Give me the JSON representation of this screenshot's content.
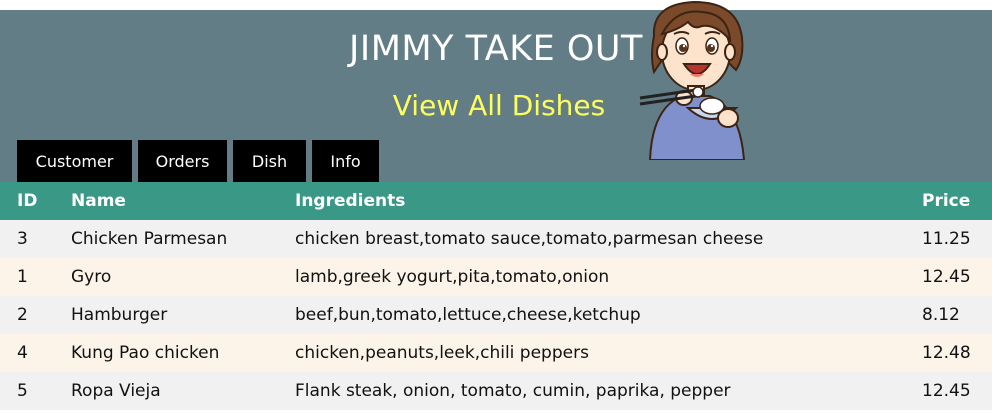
{
  "header": {
    "title": "JIMMY TAKE OUT",
    "subtitle": "View All Dishes",
    "mascot_icon": "chef-eating-rice-icon"
  },
  "nav": {
    "items": [
      {
        "label": "Customer"
      },
      {
        "label": "Orders"
      },
      {
        "label": "Dish"
      },
      {
        "label": "Info"
      }
    ]
  },
  "table": {
    "columns": [
      "ID",
      "Name",
      "Ingredients",
      "Price"
    ],
    "rows": [
      {
        "id": "3",
        "name": "Chicken Parmesan",
        "ingredients": "chicken breast,tomato sauce,tomato,parmesan cheese",
        "price": "11.25"
      },
      {
        "id": "1",
        "name": "Gyro",
        "ingredients": "lamb,greek yogurt,pita,tomato,onion",
        "price": "12.45"
      },
      {
        "id": "2",
        "name": "Hamburger",
        "ingredients": "beef,bun,tomato,lettuce,cheese,ketchup",
        "price": "8.12"
      },
      {
        "id": "4",
        "name": "Kung Pao chicken",
        "ingredients": "chicken,peanuts,leek,chili peppers",
        "price": "12.48"
      },
      {
        "id": "5",
        "name": "Ropa Vieja",
        "ingredients": "Flank steak, onion, tomato, cumin, paprika, pepper",
        "price": "12.45"
      }
    ]
  },
  "colors": {
    "header_bg": "#637d87",
    "subtitle": "#ffff5c",
    "table_header_bg": "#3a9886",
    "row_odd": "#f1f1f1",
    "row_even": "#fcf4e8",
    "nav_bg": "#000000"
  }
}
